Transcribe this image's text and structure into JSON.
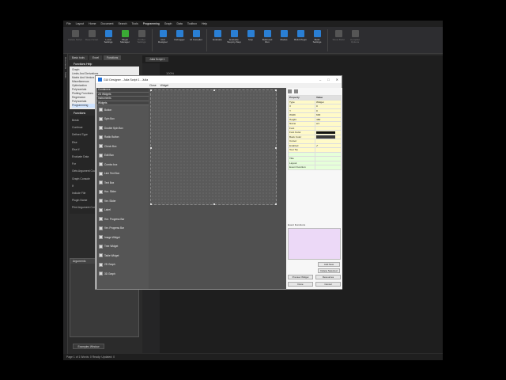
{
  "menu": [
    "File",
    "Layout",
    "Home",
    "Document",
    "Search",
    "Tools",
    "Programming",
    "Graph",
    "Data",
    "Toolbox",
    "Help"
  ],
  "menu_active": "Programming",
  "ribbon": [
    {
      "label": "Delete Script",
      "icon": "delete-script-icon",
      "color": "#888",
      "dim": true
    },
    {
      "label": "Reset Script",
      "icon": "reset-script-icon",
      "color": "#888",
      "dim": true
    },
    {
      "label": "Local Settings",
      "icon": "local-settings-icon",
      "color": "#2a7fd4"
    },
    {
      "label": "Plugin Manager",
      "icon": "plugin-manager-icon",
      "color": "#3aaa35"
    },
    {
      "label": "Profiler Settings",
      "icon": "profiler-icon",
      "color": "#888",
      "dim": true
    },
    {
      "label": "GUI Designer",
      "icon": "gui-designer-icon",
      "color": "#2a7fd4"
    },
    {
      "label": "Debugger",
      "icon": "debugger-icon",
      "color": "#2a7fd4"
    },
    {
      "label": "AI Compiler",
      "icon": "ai-compiler-icon",
      "color": "#2a7fd4"
    },
    {
      "label": "Evaluate",
      "icon": "evaluate-icon",
      "color": "#2a7fd4"
    },
    {
      "label": "Evaluate Step-by-Step",
      "icon": "step-icon",
      "color": "#2a7fd4"
    },
    {
      "label": "Stop",
      "icon": "stop-icon",
      "color": "#2a7fd4"
    },
    {
      "label": "Build and Run",
      "icon": "build-run-icon",
      "color": "#2a7fd4"
    },
    {
      "label": "Modes",
      "icon": "modes-icon",
      "color": "#2a7fd4"
    },
    {
      "label": "Build Plugin",
      "icon": "build-plugin-icon",
      "color": "#2a7fd4"
    },
    {
      "label": "Build Settings",
      "icon": "build-settings-icon",
      "color": "#2a7fd4"
    },
    {
      "label": "Show Build",
      "icon": "show-build-icon",
      "color": "#888",
      "dim": true
    },
    {
      "label": "Compiler Options",
      "icon": "compiler-options-icon",
      "color": "#888",
      "dim": true
    }
  ],
  "vstrip": [
    "Documents",
    "Tasks"
  ],
  "left_tabs": [
    "Basic tools",
    "Excel",
    "Functions"
  ],
  "functions_help": "Functions Help",
  "fn_list": [
    "Graph",
    "Limits And Derivatives",
    "Matrix And Vectors",
    "Miscellaneous",
    "Optimization",
    "Polynomials",
    "Plotting Functions",
    "Regression",
    "Polynomials",
    "Programming"
  ],
  "fn_highlight": 9,
  "fn_box_title": "Functions",
  "fn_box": [
    "Break",
    "Continue",
    "Defined Type",
    "Else",
    "Else If",
    "Evaluate Data",
    "For",
    "Gets Argument Count",
    "Graph Console",
    "If",
    "Include File",
    "Plugin Name",
    "Print Argument Console"
  ],
  "arguments_title": "Arguments",
  "examples_button": "Examples Window",
  "editor_tab": "Julia Script 1",
  "editor_line": "100%",
  "status": "Page 1 of 1    Words: 0    Ready: Updated: 0",
  "dialog": {
    "title": "GUI Designer - Julia Script 1 - Julia",
    "menu": [
      "Close",
      "Widget"
    ],
    "sections": [
      "Containers",
      "2D Widgets",
      "Instruments",
      "Widgets"
    ],
    "widgets": [
      {
        "label": "Button",
        "icon": "button-widget-icon"
      },
      {
        "label": "Spin Box",
        "icon": "spin-box-icon"
      },
      {
        "label": "Double Spin Box",
        "icon": "double-spin-box-icon"
      },
      {
        "label": "Radio Button",
        "icon": "radio-button-icon"
      },
      {
        "label": "Check Box",
        "icon": "check-box-icon"
      },
      {
        "label": "Edit Box",
        "icon": "edit-box-icon"
      },
      {
        "label": "Combo box",
        "icon": "combo-box-icon"
      },
      {
        "label": "Line Text Box",
        "icon": "line-text-box-icon"
      },
      {
        "label": "Text Box",
        "icon": "text-box-icon"
      },
      {
        "label": "Hor. Slider",
        "icon": "hor-slider-icon"
      },
      {
        "label": "Ver. Slider",
        "icon": "ver-slider-icon"
      },
      {
        "label": "Label",
        "icon": "label-widget-icon"
      },
      {
        "label": "Hor. Progress Bar",
        "icon": "hor-progress-icon"
      },
      {
        "label": "Ver. Progress Bar",
        "icon": "ver-progress-icon"
      },
      {
        "label": "Image Widget",
        "icon": "image-widget-icon"
      },
      {
        "label": "Tree Widget",
        "icon": "tree-widget-icon"
      },
      {
        "label": "Table Widget",
        "icon": "table-widget-icon"
      },
      {
        "label": "2D Graph",
        "icon": "graph-2d-icon"
      },
      {
        "label": "3D Graph",
        "icon": "graph-3d-icon"
      }
    ],
    "props_header": {
      "k": "Property",
      "v": "Value"
    },
    "props": [
      {
        "k": "Type",
        "v": "Widget",
        "c": "y"
      },
      {
        "k": "X",
        "v": "0",
        "c": "y"
      },
      {
        "k": "Y",
        "v": "0",
        "c": "y"
      },
      {
        "k": "Width",
        "v": "600",
        "c": "y"
      },
      {
        "k": "Height",
        "v": "480",
        "c": "y"
      },
      {
        "k": "Name",
        "v": "w1",
        "c": "y"
      },
      {
        "k": "Font",
        "v": "",
        "c": "y"
      },
      {
        "k": "Font Color",
        "v": "",
        "c": "y",
        "swatch": "#111111"
      },
      {
        "k": "Back Color",
        "v": "",
        "c": "y",
        "swatch": "#3a3a3a"
      },
      {
        "k": "Cursor",
        "v": "",
        "c": "y"
      },
      {
        "k": "Enabled",
        "v": "✔",
        "c": "y"
      },
      {
        "k": "Tool Tip",
        "v": "",
        "c": "y"
      },
      {
        "k": "",
        "v": "",
        "c": "g"
      },
      {
        "k": "Title",
        "v": "",
        "c": "g"
      },
      {
        "k": "Layout",
        "v": "",
        "c": "g"
      },
      {
        "k": "Event Function",
        "v": "",
        "c": "g"
      }
    ],
    "event_label": "Event Functions",
    "add_new": "Add New",
    "delete_selected": "Delete Selected",
    "preview": "Preview Widget",
    "resources": "Resources",
    "done": "Done",
    "cancel": "Cancel"
  }
}
